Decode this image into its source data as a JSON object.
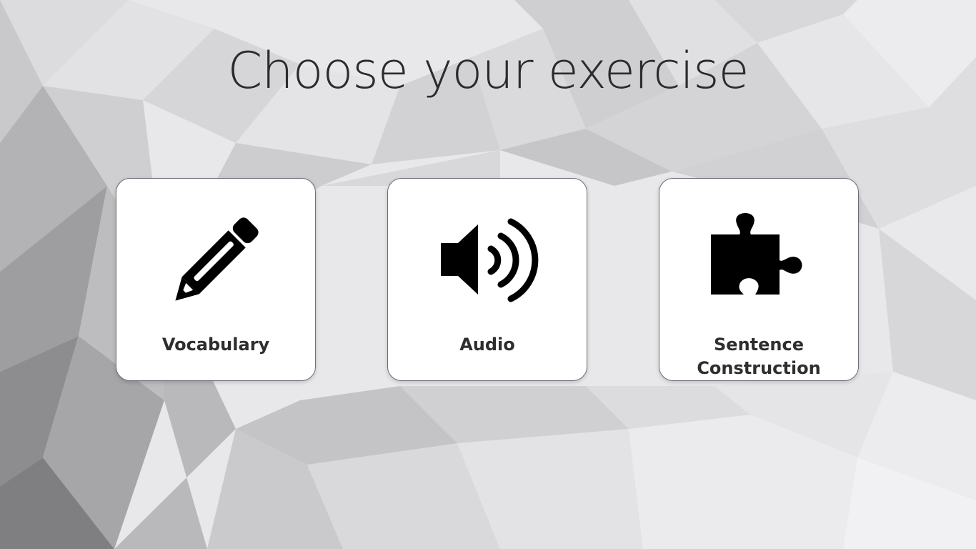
{
  "page": {
    "title": "Choose your exercise"
  },
  "exercises": [
    {
      "label": "Vocabulary",
      "icon": "pencil-icon"
    },
    {
      "label": "Audio",
      "icon": "speaker-icon"
    },
    {
      "label": "Sentence\nConstruction",
      "icon": "puzzle-piece-icon"
    }
  ],
  "colors": {
    "title": "#2b2b2b",
    "card_background": "#ffffff",
    "card_border": "#6b6f76",
    "icon": "#000000"
  }
}
